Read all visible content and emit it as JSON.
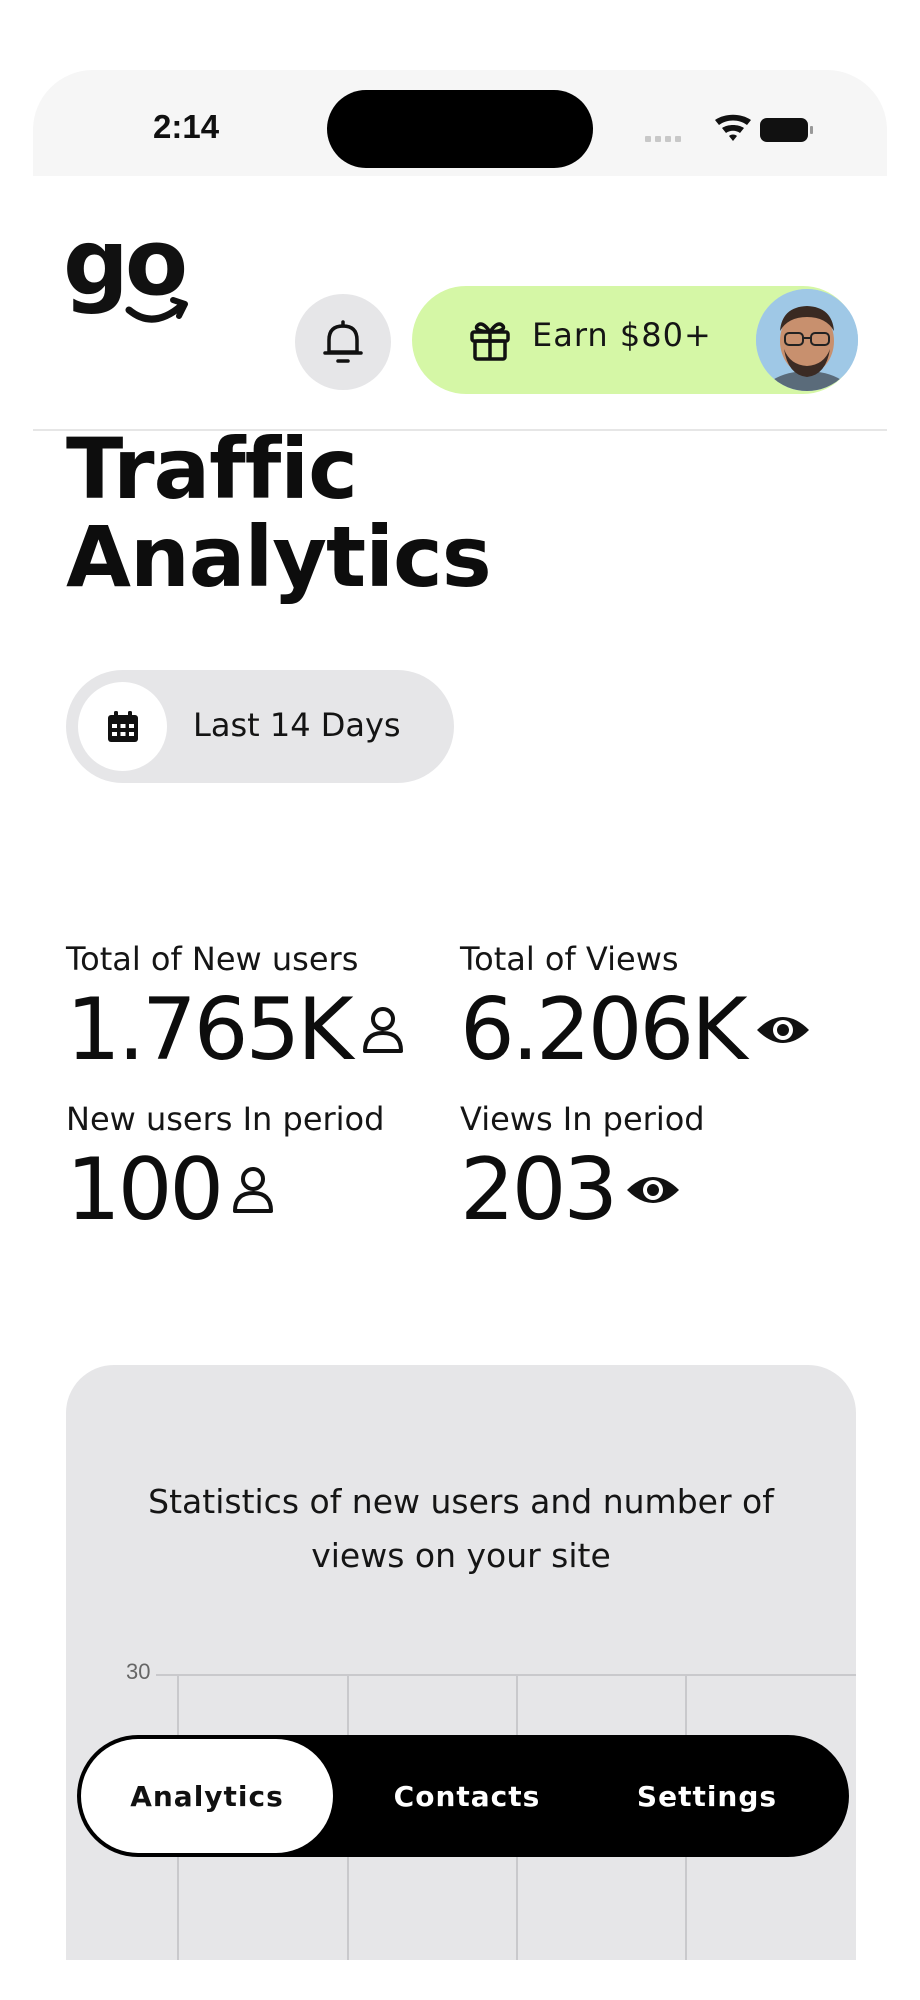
{
  "status_bar": {
    "time": "2:14"
  },
  "header": {
    "logo_text": "go",
    "earn_label": "Earn $80+"
  },
  "page": {
    "title_line1": "Traffic",
    "title_line2": "Analytics"
  },
  "date_filter": {
    "label": "Last 14 Days"
  },
  "stats": {
    "total_new_users_label": "Total of New users",
    "total_new_users_value": "1.765K",
    "total_views_label": "Total of Views",
    "total_views_value": "6.206K",
    "new_users_period_label": "New users In period",
    "new_users_period_value": "100",
    "views_period_label": "Views In period",
    "views_period_value": "203"
  },
  "card": {
    "title": "Statistics of new users and number of views on your site"
  },
  "chart_data": {
    "type": "line",
    "y_tick_labels": [
      "30"
    ],
    "grid": true
  },
  "tabbar": {
    "tabs": [
      {
        "label": "Analytics",
        "active": true
      },
      {
        "label": "Contacts",
        "active": false
      },
      {
        "label": "Settings",
        "active": false
      }
    ]
  },
  "colors": {
    "accent_green": "#d5f7a6",
    "chip_gray": "#e6e6e8",
    "tabbar_black": "#000000"
  },
  "icons": {
    "bell": "bell-icon",
    "gift": "gift-icon",
    "calendar": "calendar-icon",
    "user": "user-icon",
    "eye": "eye-icon"
  }
}
